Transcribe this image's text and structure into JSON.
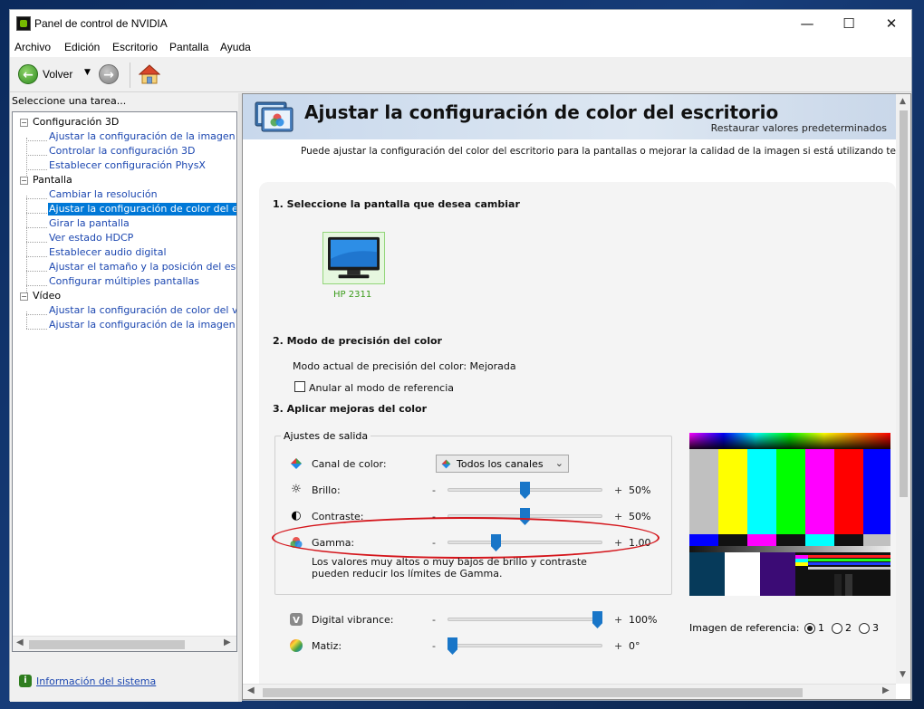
{
  "window": {
    "title": "Panel de control de NVIDIA",
    "controls": {
      "minimize": "—",
      "maximize": "☐",
      "close": "✕"
    }
  },
  "menu": [
    "Archivo",
    "Edición",
    "Escritorio",
    "Pantalla",
    "Ayuda"
  ],
  "toolbar": {
    "back_label": "Volver"
  },
  "left": {
    "task_label": "Seleccione una tarea...",
    "tree": {
      "cat1": "Configuración 3D",
      "c1i1": "Ajustar la configuración de la imagen con v",
      "c1i2": "Controlar la configuración 3D",
      "c1i3": "Establecer configuración PhysX",
      "cat2": "Pantalla",
      "c2i1": "Cambiar la resolución",
      "c2i2": "Ajustar la configuración de color del escrito",
      "c2i3": "Girar la pantalla",
      "c2i4": "Ver estado HDCP",
      "c2i5": "Establecer audio digital",
      "c2i6": "Ajustar el tamaño y la posición del escritori",
      "c2i7": "Configurar múltiples pantallas",
      "cat3": "Vídeo",
      "c3i1": "Ajustar la configuración de color del vídeo",
      "c3i2": "Ajustar la configuración de la imagen de víd"
    },
    "system_info": "Información del sistema"
  },
  "page": {
    "title": "Ajustar la configuración de color del escritorio",
    "restore": "Restaurar valores predeterminados",
    "description": "Puede ajustar la configuración del color del escritorio para la pantallas o mejorar la calidad de la imagen si está utilizando televisores.",
    "section1": "1. Seleccione la pantalla que desea cambiar",
    "monitor_name": "HP 2311",
    "section2": "2. Modo de precisión del color",
    "precision_mode": "Modo actual de precisión del color: Mejorada",
    "reference_mode": "Anular al modo de referencia",
    "section3": "3. Aplicar mejoras del color",
    "output_group": "Ajustes de salida",
    "channel_label": "Canal de color:",
    "channel_value": "Todos los canales",
    "brightness": {
      "label": "Brillo:",
      "value": "50%",
      "level": 0.5
    },
    "contrast": {
      "label": "Contraste:",
      "value": "50%",
      "level": 0.5
    },
    "gamma": {
      "label": "Gamma:",
      "value": "1.00",
      "level": 0.3
    },
    "warning": "Los valores muy altos o muy bajos de brillo y contraste pueden reducir los límites de Gamma.",
    "vibrance": {
      "label": "Digital vibrance:",
      "value": "100%",
      "level": 1.0
    },
    "hue": {
      "label": "Matiz:",
      "value": "0°",
      "level": 0.0
    },
    "minus": "-",
    "plus": "+",
    "reference_image_label": "Imagen de referencia:",
    "reference_options": [
      "1",
      "2",
      "3"
    ],
    "reference_selected": "1"
  },
  "colors": {
    "accent": "#0078d7",
    "link": "#1c47b0",
    "slider_thumb": "#1976c8",
    "annotation": "#d4151b",
    "nvidia_green": "#76b900"
  }
}
